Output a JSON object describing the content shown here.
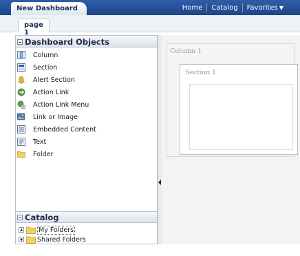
{
  "header": {
    "title": "New Dashboard",
    "nav": [
      "Home",
      "Catalog",
      "Favorites"
    ]
  },
  "tabs": [
    {
      "label": "page 1",
      "active": true
    }
  ],
  "dashboard_objects": {
    "title": "Dashboard Objects",
    "items": [
      {
        "label": "Column",
        "icon": "column-icon"
      },
      {
        "label": "Section",
        "icon": "section-icon"
      },
      {
        "label": "Alert Section",
        "icon": "alert-bell-icon"
      },
      {
        "label": "Action Link",
        "icon": "action-link-icon"
      },
      {
        "label": "Action Link Menu",
        "icon": "action-link-menu-icon"
      },
      {
        "label": "Link or Image",
        "icon": "link-image-icon"
      },
      {
        "label": "Embedded Content",
        "icon": "embedded-content-icon"
      },
      {
        "label": "Text",
        "icon": "text-icon"
      },
      {
        "label": "Folder",
        "icon": "folder-icon"
      }
    ]
  },
  "catalog": {
    "title": "Catalog",
    "items": [
      {
        "label": "My Folders",
        "selected": true
      },
      {
        "label": "Shared Folders",
        "selected": false
      }
    ]
  },
  "canvas": {
    "column_label": "Column 1",
    "section_label": "Section 1"
  },
  "colors": {
    "header_blue": "#1c4488",
    "panel_border": "#b5bfcd",
    "folder_yellow": "#f2d35a"
  }
}
